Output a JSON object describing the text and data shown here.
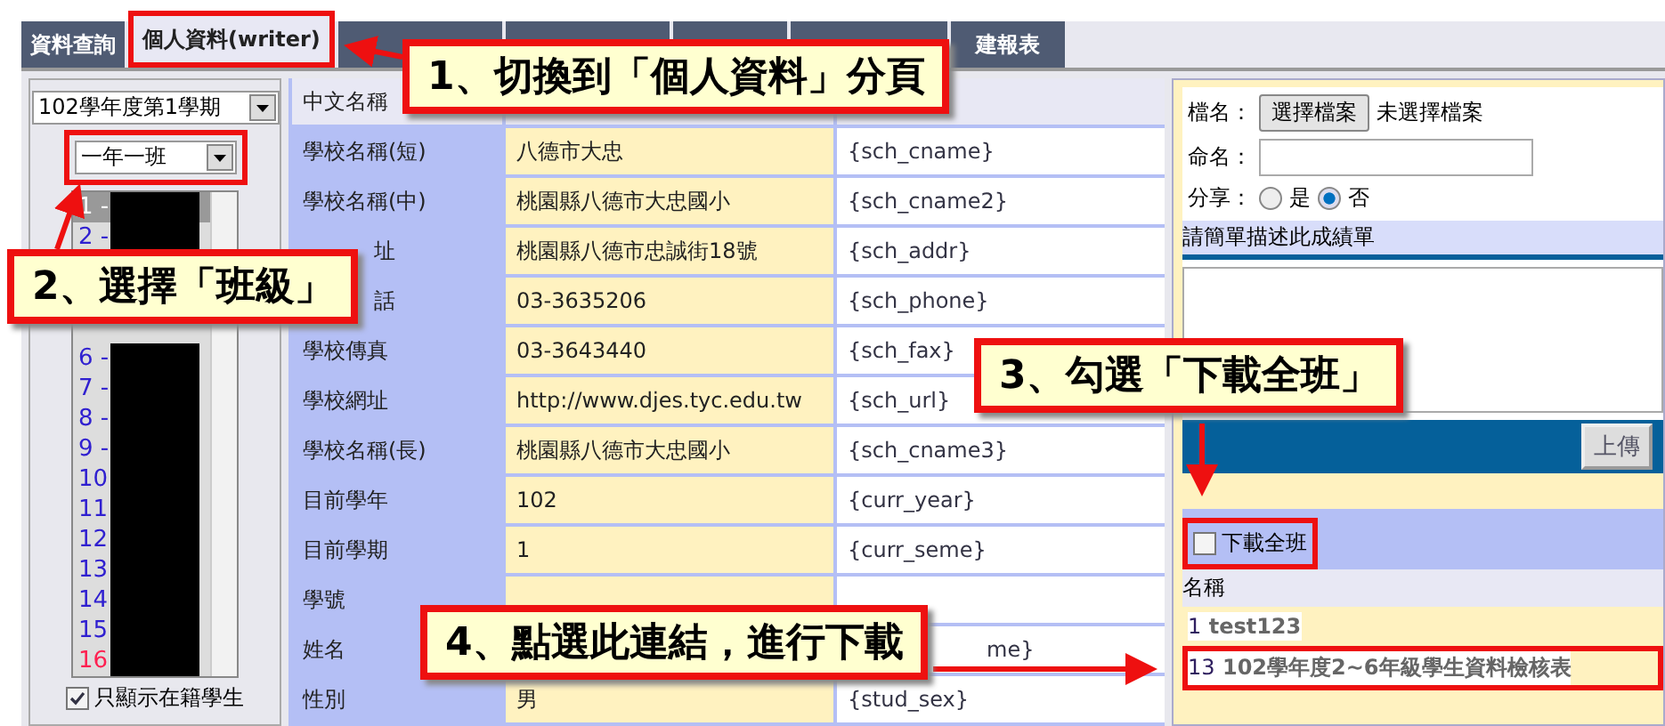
{
  "tabs": [
    {
      "label": "資料查詢",
      "selected": false,
      "highlighted": false
    },
    {
      "label": "個人資料(writer)",
      "selected": true,
      "highlighted": true
    },
    {
      "selected": false,
      "highlighted": false
    },
    {
      "selected": false,
      "highlighted": false
    },
    {
      "selected": false,
      "highlighted": false
    },
    {
      "selected": false,
      "highlighted": false
    },
    {
      "label": "建報表",
      "selected": false,
      "highlighted": false
    }
  ],
  "sidebar": {
    "semester": "102學年度第1學期",
    "class_select": {
      "value": "一年一班",
      "highlighted": true
    },
    "students": [
      {
        "number": "1 -",
        "selected": true,
        "kind": "normal"
      },
      {
        "number": "2 -",
        "selected": false,
        "kind": "normal"
      },
      {
        "number": "6 -",
        "selected": false,
        "kind": "normal"
      },
      {
        "number": "7 -",
        "selected": false,
        "kind": "normal"
      },
      {
        "number": "8 -",
        "selected": false,
        "kind": "normal"
      },
      {
        "number": "9 -",
        "selected": false,
        "kind": "normal"
      },
      {
        "number": "10",
        "selected": false,
        "kind": "normal"
      },
      {
        "number": "11",
        "selected": false,
        "kind": "normal"
      },
      {
        "number": "12",
        "selected": false,
        "kind": "normal"
      },
      {
        "number": "13",
        "selected": false,
        "kind": "normal"
      },
      {
        "number": "14",
        "selected": false,
        "kind": "normal"
      },
      {
        "number": "15",
        "selected": false,
        "kind": "normal"
      },
      {
        "number": "16",
        "selected": false,
        "kind": "alert"
      }
    ],
    "enrolled_only": {
      "label": "只顯示在籍學生",
      "checked": true
    }
  },
  "table": {
    "header": "中文名稱",
    "rows": [
      {
        "label": "學校名稱(短)",
        "value": "八德市大忠",
        "tag": "{sch_cname}"
      },
      {
        "label": "學校名稱(中)",
        "value": "桃園縣八德市大忠國小",
        "tag": "{sch_cname2}"
      },
      {
        "label": "址",
        "label_covered": true,
        "value": "桃園縣八德市忠誠街18號",
        "tag": "{sch_addr}"
      },
      {
        "label": "話",
        "label_covered": true,
        "value": "03-3635206",
        "tag": "{sch_phone}"
      },
      {
        "label": "學校傳真",
        "value": "03-3643440",
        "tag": "{sch_fax}"
      },
      {
        "label": "學校網址",
        "value": "http://www.djes.tyc.edu.tw",
        "tag": "{sch_url}"
      },
      {
        "label": "學校名稱(長)",
        "value": "桃園縣八德市大忠國小",
        "tag": "{sch_cname3}"
      },
      {
        "label": "目前學年",
        "value": "102",
        "tag": "{curr_year}"
      },
      {
        "label": "目前學期",
        "value": "1",
        "tag": "{curr_seme}"
      },
      {
        "label": "學號"
      },
      {
        "label": "姓名",
        "tag": "me}",
        "tag_covered": true
      },
      {
        "label": "性別",
        "value": "男",
        "tag": "{stud_sex}"
      }
    ]
  },
  "upload": {
    "file_label": "檔名：",
    "file_button": "選擇檔案",
    "file_status": "未選擇檔案",
    "name_label": "命名：",
    "share_label": "分享：",
    "share_options": [
      {
        "label": "是",
        "selected": false
      },
      {
        "label": "否",
        "selected": true
      }
    ],
    "description_header": "請簡單描述此成績單",
    "upload_button": "上傳"
  },
  "templates": {
    "download_all": {
      "label": "下載全班",
      "checked": false,
      "highlighted": true
    },
    "column": "名稱",
    "items": [
      {
        "number": "1",
        "name": "test123",
        "highlighted": false
      },
      {
        "number": "13",
        "name": "102學年度2~6年級學生資料檢核表",
        "highlighted": true
      }
    ]
  },
  "callouts": [
    {
      "text": "1、切換到「個人資料」分頁"
    },
    {
      "text": "2、選擇「班級」"
    },
    {
      "text": "3、勾選「下載全班」"
    },
    {
      "text": "4、點選此連結，進行下載"
    }
  ]
}
